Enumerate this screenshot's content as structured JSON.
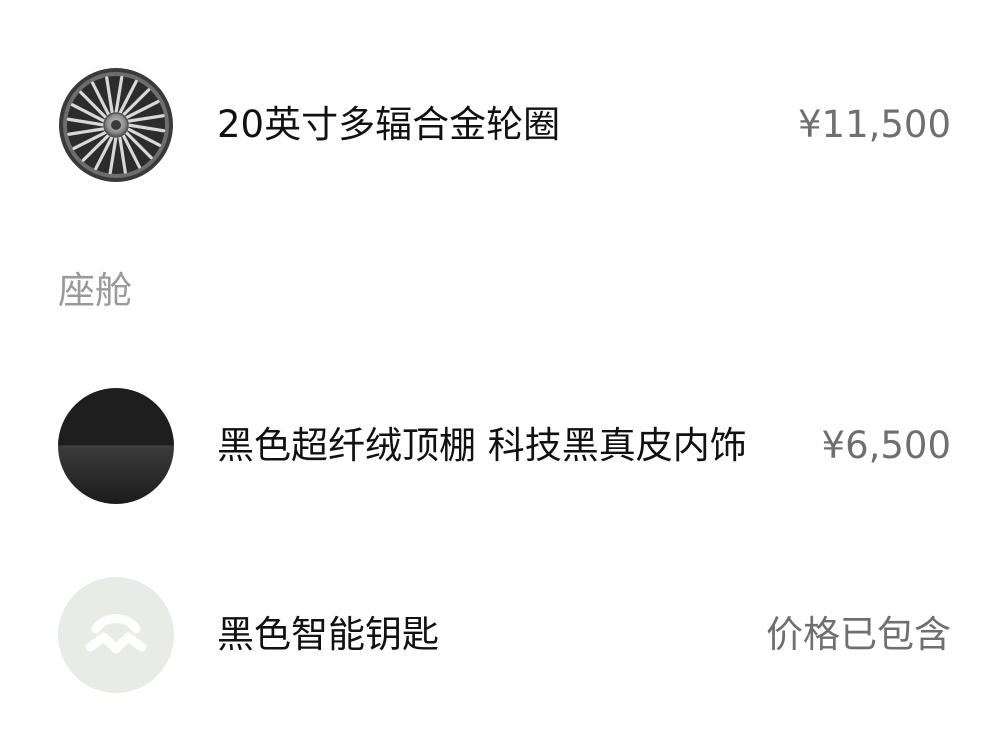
{
  "options": [
    {
      "title": "20英寸多辐合金轮圈",
      "price": "¥11,500",
      "thumbnail_icon": "alloy-wheel-icon"
    }
  ],
  "cabin": {
    "section_label": "座舱",
    "items": [
      {
        "title": "黑色超纤绒顶棚 科技黑真皮内饰",
        "price": "¥6,500",
        "thumbnail_icon": "interior-swatch-icon"
      },
      {
        "title": "黑色智能钥匙",
        "price": "价格已包含",
        "thumbnail_icon": "smart-key-icon"
      }
    ]
  },
  "colors": {
    "title_text": "#111111",
    "price_text": "#6f6f6f",
    "section_text": "#9a9a9a",
    "key_thumb_bg": "#e8ebe6"
  }
}
